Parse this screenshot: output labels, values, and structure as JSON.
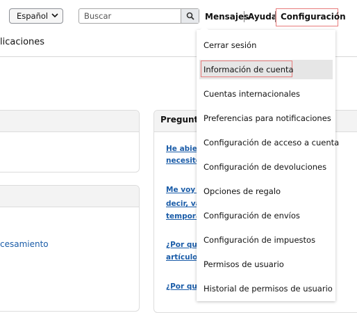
{
  "header": {
    "language": "Español",
    "search_placeholder": "Buscar",
    "links": {
      "messages": "Mensajes",
      "help": "Ayuda",
      "settings": "Configuración"
    }
  },
  "page": {
    "subtitle": "licaciones",
    "left_panel_link": "cesamiento",
    "faq": {
      "title": "Pregunta",
      "items": [
        "He abier",
        "necesito.",
        "Me voy a",
        "decir, va",
        "tempora",
        "¿Por qué",
        "artículos",
        "¿Por qué"
      ]
    }
  },
  "menu": {
    "items": [
      "Cerrar sesión",
      "Información de cuenta",
      "Cuentas internacionales",
      "Preferencias para notificaciones",
      "Configuración de acceso a cuenta",
      "Configuración de devoluciones",
      "Opciones de regalo",
      "Configuración de envíos",
      "Configuración de impuestos",
      "Permisos de usuario",
      "Historial de permisos de usuario"
    ],
    "highlighted_index": 1
  },
  "colors": {
    "highlight_border": "#e77b7b",
    "link": "#1a5ca8"
  },
  "icons": {
    "language_select": "chevron-down-icon",
    "search_button": "search-icon"
  }
}
